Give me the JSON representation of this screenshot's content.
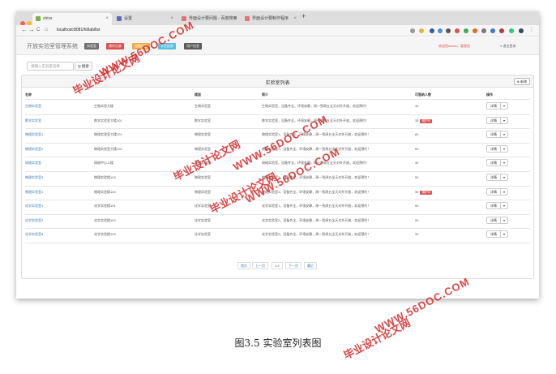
{
  "browser": {
    "tabs": [
      {
        "label": "shixs",
        "active": true
      },
      {
        "label": "设置",
        "active": false
      },
      {
        "label": "界面设计要问题 - 百度搜索",
        "active": false
      },
      {
        "label": "界面设计要制作程序",
        "active": false
      }
    ],
    "new_tab": "+",
    "back": "←",
    "forward": "→",
    "reload": "C",
    "home": "⌂",
    "url": "localhost:8081/ht/lab/list"
  },
  "app": {
    "title": "开放实验室管理系统",
    "nav": [
      {
        "label": "实验室",
        "color": "#6f6f6f"
      },
      {
        "label": "预约记录",
        "color": "#d9534f"
      },
      {
        "label": "设备信息",
        "color": "#f0ad4e"
      },
      {
        "label": "学生信息",
        "color": "#5bc0de"
      },
      {
        "label": "用户信息",
        "color": "#5a5a5a"
      }
    ],
    "welcome": "欢迎您admin，管理员",
    "logout": "退出登录"
  },
  "search": {
    "placeholder": "请输入实验室名称",
    "button": "Q 搜索"
  },
  "panel": {
    "title": "实验室列表",
    "add_button": "新增",
    "columns": [
      "名称",
      "楼层",
      "简介",
      "可容纳人数",
      "操作"
    ],
    "rows": [
      {
        "name": "生物实验室",
        "loc": "生物实验大楼",
        "type": "生物实验室",
        "desc": "生物实验室，设备齐全，环境安静，周一到周五全天对外开放，欢迎预约！",
        "cap": "40",
        "badge": ""
      },
      {
        "name": "数学实验室",
        "loc": "数学实验室大楼101",
        "type": "数学实验室",
        "desc": "数学实验室，设备齐全，环境安静，周一到周五全天对外开放，欢迎预约！",
        "cap": "30",
        "badge": "维护中"
      },
      {
        "name": "物理实验室1",
        "loc": "物理实验室大楼101",
        "type": "物理实验室",
        "desc": "物理实验室1，设备齐全，环境安静，周一到周五全天对外开放，欢迎预约！",
        "cap": "60",
        "badge": ""
      },
      {
        "name": "物理实验室2",
        "loc": "物理实验室大楼102",
        "type": "物理实验室",
        "desc": "物理实验室2，设备齐全，环境安静，周一到周五全天对外开放，欢迎预约！",
        "cap": "60",
        "badge": ""
      },
      {
        "name": "网络实验室",
        "loc": "网络中心二楼",
        "type": "网络实验室",
        "desc": "网络实验室，设备齐全，环境安静，周一到周五全天对外开放，欢迎预约！",
        "cap": "30",
        "badge": ""
      },
      {
        "name": "物理实验室3",
        "loc": "物理实验楼103",
        "type": "物理实验室",
        "desc": "物理实验室3，设备齐全，环境安静，周一到周五全天对外开放，欢迎预约！",
        "cap": "50",
        "badge": ""
      },
      {
        "name": "物理实验室4",
        "loc": "物理实验楼104",
        "type": "物理实验室",
        "desc": "物理实验室4，设备齐全，环境安静，周一到周五全天对外开放，欢迎预约！",
        "cap": "30",
        "badge": "维护中"
      },
      {
        "name": "化学实验室1",
        "loc": "化学实验楼101",
        "type": "化学实验室",
        "desc": "化学实验室1，设备齐全，环境安静，周一到周五全天对外开放，欢迎预约！",
        "cap": "50",
        "badge": ""
      },
      {
        "name": "化学实验室2",
        "loc": "化学实验楼102",
        "type": "化学实验室",
        "desc": "化学实验室2，设备齐全，环境安静，周一到周五全天对外开放，欢迎预约！",
        "cap": "50",
        "badge": ""
      },
      {
        "name": "化学实验室3",
        "loc": "化学实验楼103",
        "type": "化学实验室",
        "desc": "化学实验室3，设备齐全，环境安静，周一到周五全天对外开放，欢迎预约！",
        "cap": "30",
        "badge": ""
      }
    ],
    "op_label": "详情",
    "op_caret": "▾",
    "pager": [
      {
        "label": "首页",
        "current": false
      },
      {
        "label": "上一页",
        "current": false
      },
      {
        "label": "1/4",
        "current": true
      },
      {
        "label": "下一页",
        "current": false
      },
      {
        "label": "最后",
        "current": false
      }
    ]
  },
  "watermarks": {
    "cn": "毕业设计论文网",
    "en": "WWW.56DOC.COM"
  },
  "caption": "图3.5  实验室列表图"
}
